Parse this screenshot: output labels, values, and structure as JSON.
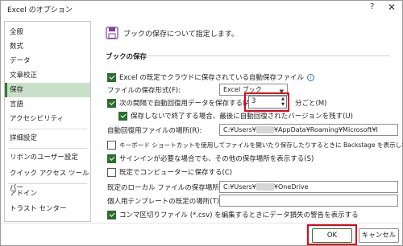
{
  "window": {
    "title": "Excel のオプション",
    "help_label": "?",
    "close_label": "✕"
  },
  "sidebar": {
    "items": [
      {
        "label": "全般"
      },
      {
        "label": "数式"
      },
      {
        "label": "データ"
      },
      {
        "label": "文章校正"
      },
      {
        "label": "保存",
        "active": true
      },
      {
        "label": "言語"
      },
      {
        "label": "アクセシビリティ"
      },
      {
        "label": "詳細設定"
      },
      {
        "label": "リボンのユーザー設定"
      },
      {
        "label": "クイック アクセス ツール バー"
      },
      {
        "label": "アドイン"
      },
      {
        "label": "トラスト センター"
      }
    ]
  },
  "header": {
    "icon": "save-disk-icon",
    "text": "ブックの保存について指定します。"
  },
  "section": {
    "title": "ブックの保存"
  },
  "options": {
    "autosave_cloud": "Excel の既定でクラウドに保存されている自動保存ファイル",
    "file_format_label": "ファイルの保存形式(F):",
    "file_format_value": "Excel ブック",
    "autorecover_label": "次の間隔で自動回復用データを保存する(A):",
    "autorecover_minutes": "3",
    "autorecover_unit": "分ごと(M)",
    "keep_last_version": "保存しないで終了する場合、最後に自動回復されたバージョンを残す(U)",
    "autorecover_location_label": "自動回復用ファイルの場所(R):",
    "autorecover_location_prefix": "C:¥Users¥",
    "autorecover_location_suffix": "¥AppData¥Roaming¥Microsoft¥I",
    "no_backstage": "キーボード ショートカットを使用してファイルを開いたり保存したりするときに Backstage を表示しない(O)",
    "show_other_locations": "サインインが必要な場合でも、その他の保存場所を表示する(S)",
    "save_to_computer": "既定でコンピューターに保存する(C)",
    "local_location_label": "既定のローカル ファイルの保存場所(I):",
    "local_location_prefix": "C:¥Users¥",
    "local_location_suffix": "¥OneDrive",
    "template_location_label": "個人用テンプレートの既定の場所(T):",
    "template_location_value": "",
    "csv_warning": "コンマ区切りファイル (*.csv) を編集するときにデータ損失の警告を表示する"
  },
  "buttons": {
    "ok": "OK",
    "cancel": "キャンセル"
  },
  "colors": {
    "accent": "#2b6e2f",
    "highlight": "#e0001a",
    "sidebar_active": "#c9dfc7"
  }
}
